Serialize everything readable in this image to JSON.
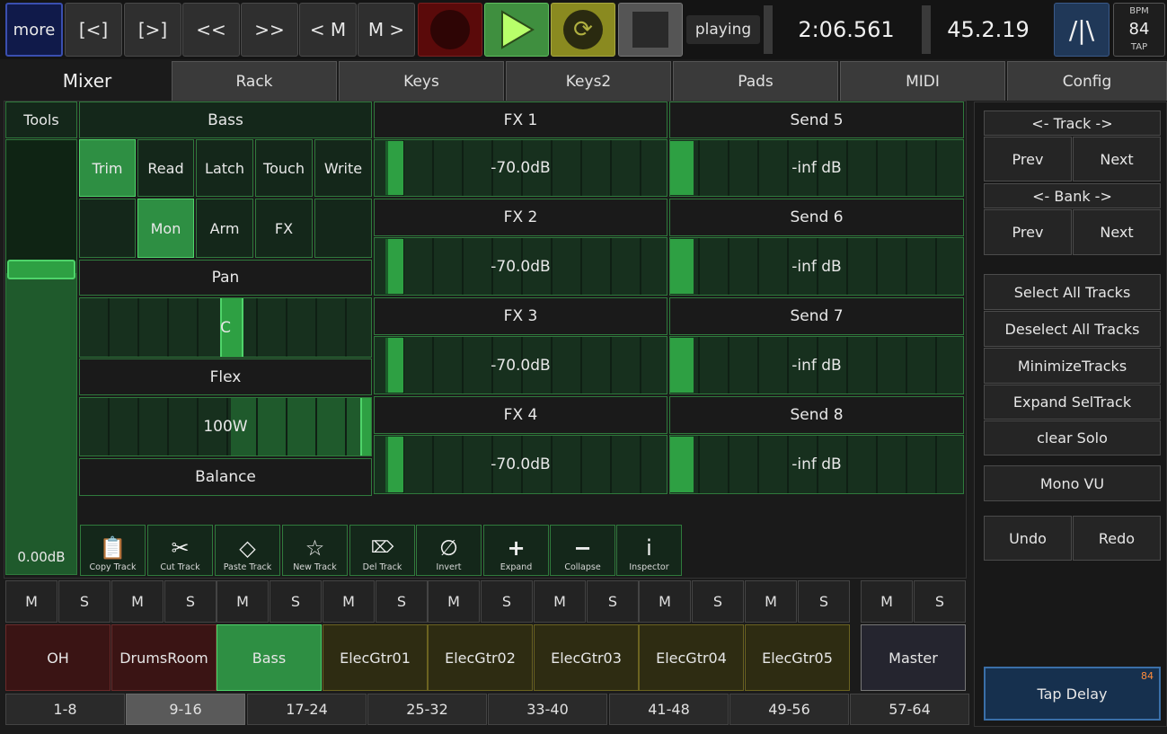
{
  "transport": {
    "more": "more",
    "prev_marker": "[<]",
    "next_marker": "[>]",
    "rewind": "<<",
    "forward": ">>",
    "prev_m": "< M",
    "next_m": "M >",
    "status": "playing",
    "time": "2:06.561",
    "bars": "45.2.19",
    "logo": "/|\\",
    "bpm_label": "BPM",
    "bpm_value": "84",
    "tap_label": "TAP"
  },
  "tabs": [
    "Mixer",
    "Rack",
    "Keys",
    "Keys2",
    "Pads",
    "MIDI",
    "Config"
  ],
  "tools_label": "Tools",
  "track": {
    "name": "Bass",
    "volume": "0.00dB",
    "automation": [
      "Trim",
      "Read",
      "Latch",
      "Touch",
      "Write"
    ],
    "buttons": [
      "",
      "Mon",
      "Arm",
      "FX",
      ""
    ],
    "pan_label": "Pan",
    "pan_value": "C",
    "flex_label": "Flex",
    "flex_value": "100W",
    "balance_label": "Balance"
  },
  "fx": [
    {
      "label": "FX 1",
      "value": "-70.0dB"
    },
    {
      "label": "FX 2",
      "value": "-70.0dB"
    },
    {
      "label": "FX 3",
      "value": "-70.0dB"
    },
    {
      "label": "FX 4",
      "value": "-70.0dB"
    }
  ],
  "sends": [
    {
      "label": "Send 5",
      "value": "-inf dB"
    },
    {
      "label": "Send 6",
      "value": "-inf dB"
    },
    {
      "label": "Send 7",
      "value": "-inf dB"
    },
    {
      "label": "Send 8",
      "value": "-inf dB"
    }
  ],
  "tools": [
    {
      "label": "Copy Track",
      "icon": "clipboard-icon",
      "glyph": "📋"
    },
    {
      "label": "Cut Track",
      "icon": "scissors-icon",
      "glyph": "✂"
    },
    {
      "label": "Paste Track",
      "icon": "tag-icon",
      "glyph": "◇"
    },
    {
      "label": "New Track",
      "icon": "star-icon",
      "glyph": "☆"
    },
    {
      "label": "Del Track",
      "icon": "delete-icon",
      "glyph": "⌦"
    },
    {
      "label": "Invert",
      "icon": "invert-icon",
      "glyph": "∅"
    },
    {
      "label": "Expand",
      "icon": "plus-icon",
      "glyph": "+"
    },
    {
      "label": "Collapse",
      "icon": "minus-icon",
      "glyph": "−"
    },
    {
      "label": "Inspector",
      "icon": "info-icon",
      "glyph": "i"
    }
  ],
  "ms": {
    "m": "M",
    "s": "S"
  },
  "tracks": [
    {
      "name": "OH",
      "color": "#3a1414",
      "border": "#6a2a2a"
    },
    {
      "name": "DrumsRoom",
      "color": "#3a1414",
      "border": "#6a2a2a"
    },
    {
      "name": "Bass",
      "color": "#2e8f43",
      "border": "#4fd46a"
    },
    {
      "name": "ElecGtr01",
      "color": "#2e2c12",
      "border": "#6b6320"
    },
    {
      "name": "ElecGtr02",
      "color": "#2e2c12",
      "border": "#6b6320"
    },
    {
      "name": "ElecGtr03",
      "color": "#2e2c12",
      "border": "#6b6320"
    },
    {
      "name": "ElecGtr04",
      "color": "#2e2c12",
      "border": "#6b6320"
    },
    {
      "name": "ElecGtr05",
      "color": "#2e2c12",
      "border": "#6b6320"
    }
  ],
  "master": "Master",
  "banks": [
    "1-8",
    "9-16",
    "17-24",
    "25-32",
    "33-40",
    "41-48",
    "49-56",
    "57-64"
  ],
  "side": {
    "track_nav": "<-  Track  ->",
    "bank_nav": "<-  Bank  ->",
    "prev": "Prev",
    "next": "Next",
    "select_all": "Select All Tracks",
    "deselect_all": "Deselect All Tracks",
    "minimize": "MinimizeTracks",
    "expand_sel": "Expand SelTrack",
    "clear_solo": "clear Solo",
    "mono_vu": "Mono VU",
    "undo": "Undo",
    "redo": "Redo",
    "tap_delay": "Tap Delay",
    "tap_value": "84"
  },
  "colors": {
    "accent": "#2e8f43",
    "record": "#5a0a0a",
    "play": "#3f8f3f",
    "loop": "#8a8a20"
  }
}
